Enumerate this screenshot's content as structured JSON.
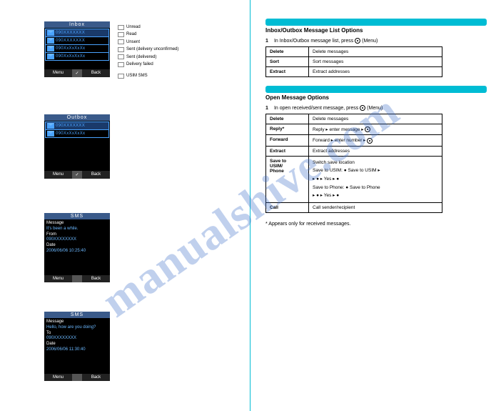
{
  "watermark": "manualshive.com",
  "left": {
    "phones": {
      "inbox": {
        "title": "Inbox",
        "rows": [
          "090XXXXXXX",
          "090XXXXXXX",
          "090XxXxXxXx",
          "090XxXxXxXx"
        ],
        "menu": "Menu",
        "mid": "✓",
        "back": "Back"
      },
      "outbox": {
        "title": "Outbox",
        "rows": [
          "090XXXXXXX",
          "090XxXxXxXx"
        ],
        "menu": "Menu",
        "mid": "✓",
        "back": "Back"
      },
      "sms_in": {
        "title": "SMS",
        "label_msg": "Message",
        "msg": "It's been a while.",
        "label_from": "From",
        "from": "090XXXXXXXX",
        "label_date": "Date",
        "date": "2006/06/06 10:25:40",
        "menu": "Menu",
        "back": "Back"
      },
      "sms_out": {
        "title": "SMS",
        "label_msg": "Message",
        "msg": "Hello, how are you doing?",
        "label_to": "To",
        "to": "090XXXXXXXX",
        "label_date": "Date",
        "date": "2006/06/06 11:30:40",
        "menu": "Menu",
        "back": "Back"
      }
    },
    "legend": {
      "unread": "Unread",
      "read": "Read",
      "unsent": "Unsent",
      "sent": "Sent (delivery unconfirmed)",
      "delivered": "Sent (delivered)",
      "failed": "Delivery failed",
      "sim": "USIM SMS"
    }
  },
  "right": {
    "section1": {
      "title": "Inbox/Outbox Message List Options",
      "step": "In Inbox/Outbox message list, press",
      "step_tail": "(Menu)",
      "table": [
        [
          "Delete",
          "Delete messages"
        ],
        [
          "Sort",
          "Sort messages"
        ],
        [
          "Extract",
          "Extract addresses"
        ]
      ]
    },
    "section2": {
      "title": "Open Message Options",
      "step": "In open received/sent message, press",
      "step_tail": "(Menu)",
      "table": [
        [
          "Delete",
          "Delete messages"
        ],
        [
          "Reply*",
          "Reply ▸ enter message ▸"
        ],
        [
          "Forward",
          "Forward ▸ enter number ▸"
        ],
        [
          "Extract",
          "Extract addresses"
        ],
        [
          "Save to\nUSIM/\nPhone",
          "Switch save location\nSave to USIM: ● Save to USIM ▸\n▸ ● ▸ Yes ▸ ●\nSave to Phone: ● Save to Phone\n▸ ● ▸ Yes ▸ ●"
        ],
        [
          "Call",
          "Call sender/recipient"
        ]
      ],
      "note": "* Appears only for received messages."
    }
  }
}
